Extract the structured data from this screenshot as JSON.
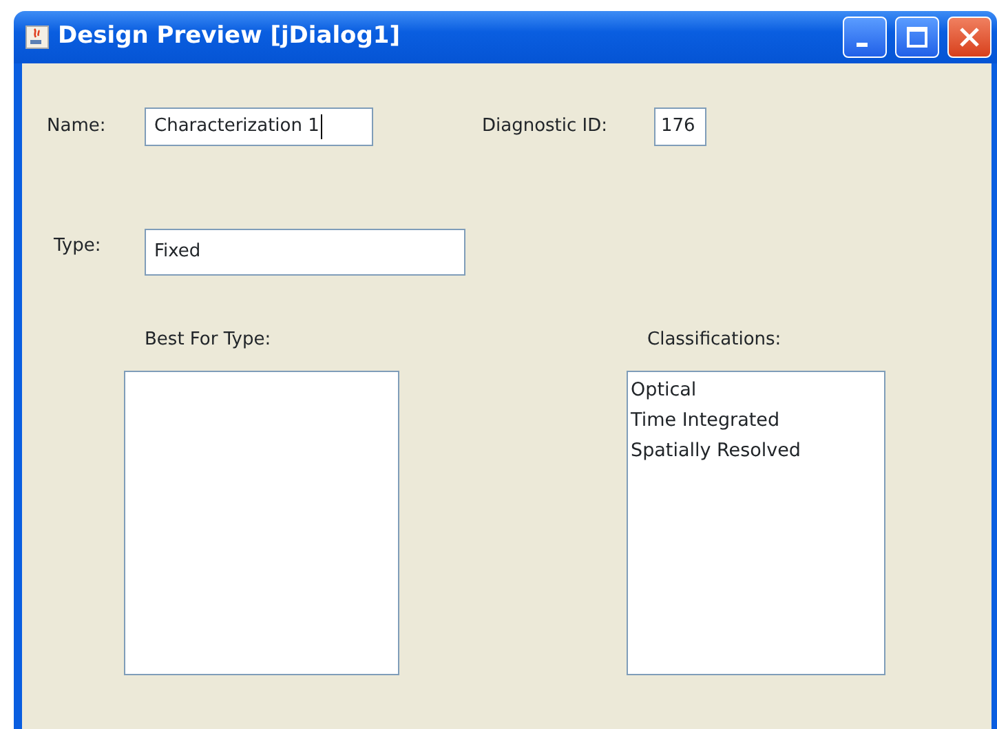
{
  "window": {
    "title": "Design Preview [jDialog1]"
  },
  "fields": [
    {
      "label": "Name:",
      "value": "Characterization 1",
      "focused": true
    },
    {
      "label": "Diagnostic ID:",
      "value": "176",
      "focused": false
    },
    {
      "label": "Type:",
      "value": "Fixed",
      "focused": false
    }
  ],
  "lists": [
    {
      "label": "Best For Type:"
    },
    {
      "label": "Classifications:",
      "items": [
        "Optical",
        "Time Integrated",
        "Spatially Resolved"
      ]
    }
  ]
}
